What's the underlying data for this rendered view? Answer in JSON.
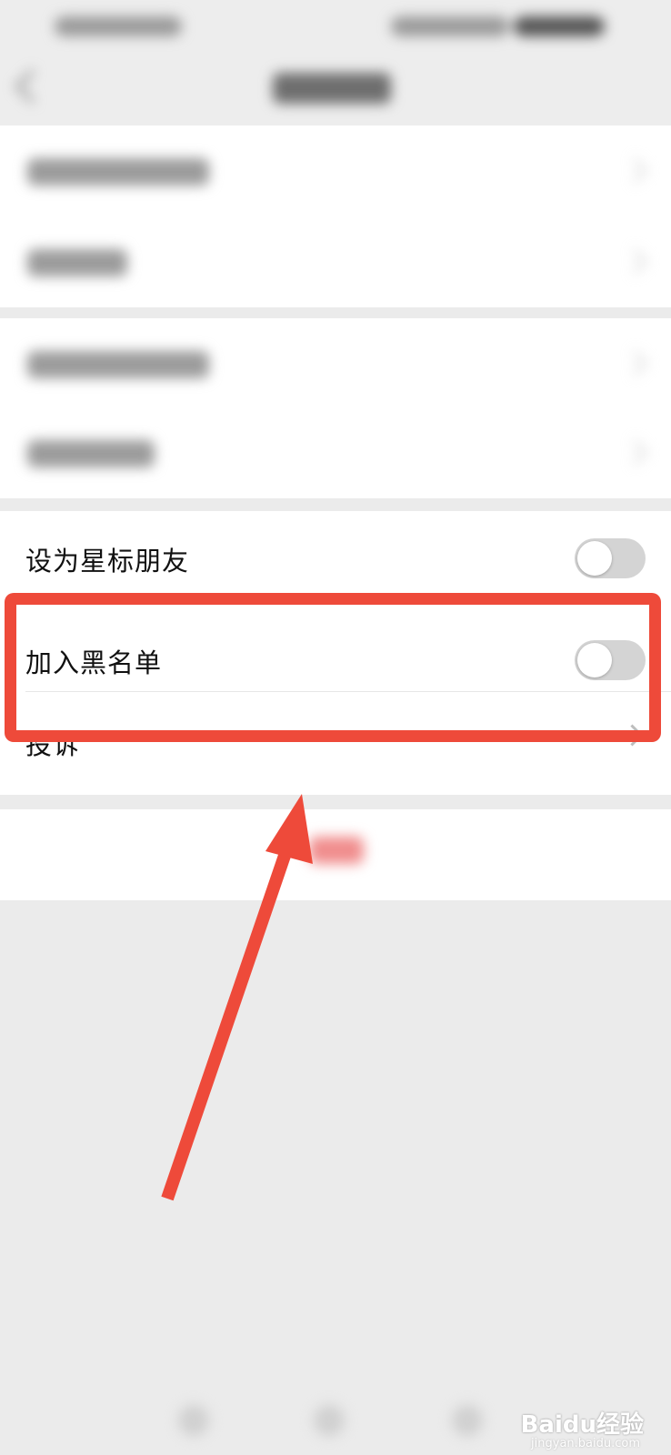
{
  "settings": {
    "star_friend_label": "设为星标朋友",
    "star_friend_on": false,
    "blacklist_label": "加入黑名单",
    "blacklist_on": false,
    "complain_label": "投诉"
  },
  "annotation": {
    "color": "#ee4a3a"
  },
  "watermark": {
    "brand": "Baidu经验",
    "url": "jingyan.baidu.com"
  }
}
